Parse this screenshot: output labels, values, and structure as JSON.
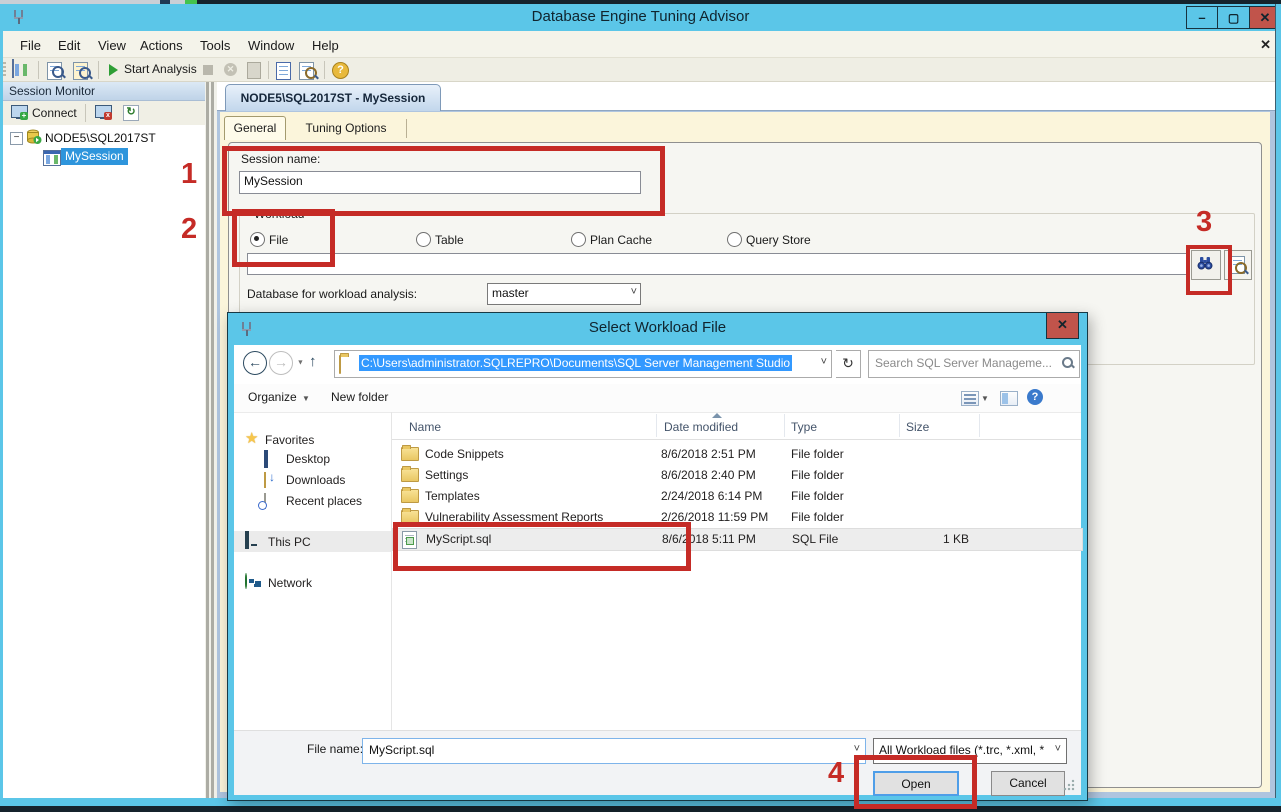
{
  "colors": {
    "titlebar_blue": "#5BC6E8",
    "close_button_red": "#C1544B",
    "annotation_red": "#C52B26",
    "tree_selection_blue": "#2E95DC",
    "tab_page_cream": "#FBF5DB"
  },
  "window": {
    "title": "Database Engine Tuning Advisor",
    "menu": [
      "File",
      "Edit",
      "View",
      "Actions",
      "Tools",
      "Window",
      "Help"
    ],
    "toolbar": {
      "start_analysis": "Start Analysis"
    }
  },
  "session_monitor": {
    "title": "Session Monitor",
    "connect_label": "Connect",
    "server": "NODE5\\SQL2017ST",
    "session": "MySession"
  },
  "document": {
    "tab_title": "NODE5\\SQL2017ST - MySession",
    "tabs": [
      "General",
      "Tuning Options"
    ],
    "session_name_label": "Session name:",
    "session_name_value": "MySession",
    "workload_label": "Workload",
    "workload_options": [
      "File",
      "Table",
      "Plan Cache",
      "Query Store"
    ],
    "workload_selected": "File",
    "db_label": "Database for workload analysis:",
    "db_value": "master"
  },
  "dialog": {
    "title": "Select Workload File",
    "address": "C:\\Users\\administrator.SQLREPRO\\Documents\\SQL Server Management Studio",
    "search_placeholder": "Search SQL Server Manageme...",
    "organize_label": "Organize",
    "new_folder_label": "New folder",
    "columns": [
      "Name",
      "Date modified",
      "Type",
      "Size"
    ],
    "sidebar": {
      "favorites": "Favorites",
      "desktop": "Desktop",
      "downloads": "Downloads",
      "recent": "Recent places",
      "this_pc": "This PC",
      "network": "Network"
    },
    "files": [
      {
        "name": "Code Snippets",
        "date": "8/6/2018 2:51 PM",
        "type": "File folder",
        "size": ""
      },
      {
        "name": "Settings",
        "date": "8/6/2018 2:40 PM",
        "type": "File folder",
        "size": ""
      },
      {
        "name": "Templates",
        "date": "2/24/2018 6:14 PM",
        "type": "File folder",
        "size": ""
      },
      {
        "name": "Vulnerability Assessment Reports",
        "date": "2/26/2018 11:59 PM",
        "type": "File folder",
        "size": ""
      },
      {
        "name": "MyScript.sql",
        "date": "8/6/2018 5:11 PM",
        "type": "SQL File",
        "size": "1 KB"
      }
    ],
    "file_name_label": "File name:",
    "file_name_value": "MyScript.sql",
    "file_type_value": "All Workload files (*.trc, *.xml, *",
    "open_label": "Open",
    "cancel_label": "Cancel"
  },
  "annotations": {
    "n1": "1",
    "n2": "2",
    "n3": "3",
    "n4": "4"
  }
}
